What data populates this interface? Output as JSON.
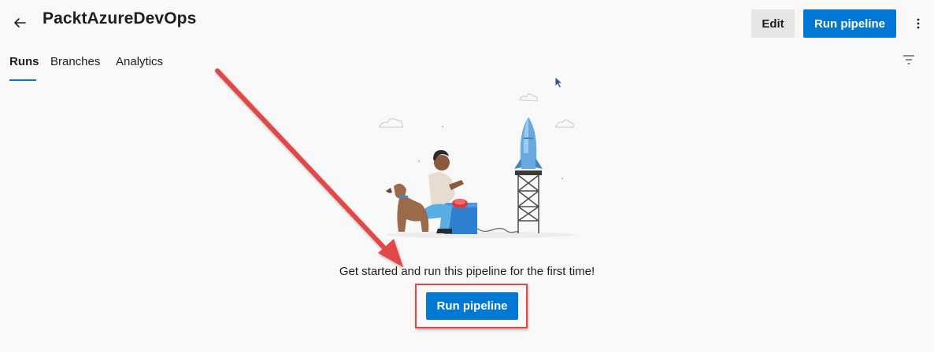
{
  "header": {
    "title": "PacktAzureDevOps",
    "back_icon": "arrow-left-icon",
    "edit_label": "Edit",
    "run_pipeline_label": "Run pipeline",
    "more_icon": "more-vertical-icon"
  },
  "tabs": [
    {
      "label": "Runs",
      "active": true
    },
    {
      "label": "Branches",
      "active": false
    },
    {
      "label": "Analytics",
      "active": false
    }
  ],
  "toolbar": {
    "filter_icon": "filter-icon"
  },
  "empty_state": {
    "illustration": "person-dog-rocket-launch-illustration",
    "message": "Get started and run this pipeline for the first time!",
    "button_label": "Run pipeline"
  },
  "annotation": {
    "arrow_color": "#e04848",
    "highlight_color": "#e04848"
  },
  "colors": {
    "accent": "#0078d4",
    "background": "#f8f8f8",
    "secondary_button": "#e6e6e6"
  }
}
